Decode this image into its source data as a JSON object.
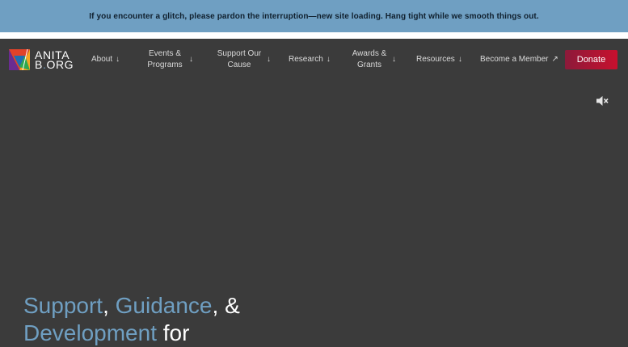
{
  "banner": {
    "text": "If you encounter a glitch, please pardon the interruption—new site loading. Hang tight while we smooth things out."
  },
  "logo": {
    "line1": "ANITA",
    "line2_a": "B",
    "line2_dot": ".",
    "line2_b": "ORG"
  },
  "nav": {
    "items": [
      {
        "label": "About",
        "arrow": "↓"
      },
      {
        "label": "Events & Programs",
        "arrow": "↓"
      },
      {
        "label": "Support Our Cause",
        "arrow": "↓"
      },
      {
        "label": "Research",
        "arrow": "↓"
      },
      {
        "label": "Awards & Grants",
        "arrow": "↓"
      },
      {
        "label": "Resources",
        "arrow": "↓"
      },
      {
        "label": "Become a Member",
        "arrow": "↗"
      }
    ],
    "donate_label": "Donate"
  },
  "hero": {
    "word1": "Support",
    "sep1": ", ",
    "word2": "Guidance",
    "sep2": ", &",
    "word3": "Development",
    "tail": " for"
  },
  "colors": {
    "accent": "#6f9fc2",
    "donate": "#c8102e",
    "background": "#3b3b3b"
  },
  "icons": [
    "logo-mark-icon",
    "mute-icon",
    "arrow-down-icon",
    "arrow-up-right-icon"
  ]
}
